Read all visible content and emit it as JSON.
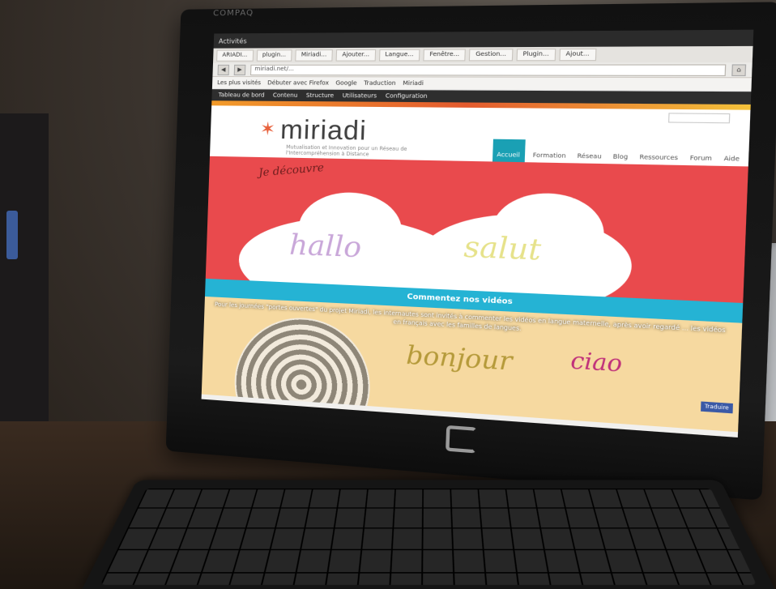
{
  "browser": {
    "activities": "Activités",
    "tabs": [
      "ARIADI...",
      "plugin...",
      "Miriadi...",
      "Ajouter...",
      "Langue...",
      "Fenêtre...",
      "Gestion...",
      "Plugin...",
      "Ajout..."
    ],
    "url": "miriadi.net/...",
    "bookmarks": [
      "Les plus visités",
      "Débuter avec Firefox",
      "Google",
      "Traduction",
      "Miriadi"
    ]
  },
  "admin_bar": [
    "Tableau de bord",
    "Contenu",
    "Structure",
    "Utilisateurs",
    "Configuration"
  ],
  "site": {
    "name": "miriadi",
    "tagline": "Mutualisation et Innovation pour un Réseau de l'Intercompréhension à Distance",
    "menu": [
      "Accueil",
      "Formation",
      "Réseau",
      "Blog",
      "Ressources",
      "Forum",
      "Aide"
    ],
    "hero_words": [
      "Je découvre",
      "hallo",
      "salut",
      "bonjour",
      "ciao"
    ],
    "caption": "Commentez nos vidéos",
    "description": "Pour les journées \"portes ouvertes\" du projet Miriadi, les internautes sont invités à commenter les vidéos en langue maternelle, après avoir regardé ... les vidéos en français avec les familles de langues.",
    "badge": "Traduire"
  },
  "monitor_brand": "COMPAQ"
}
